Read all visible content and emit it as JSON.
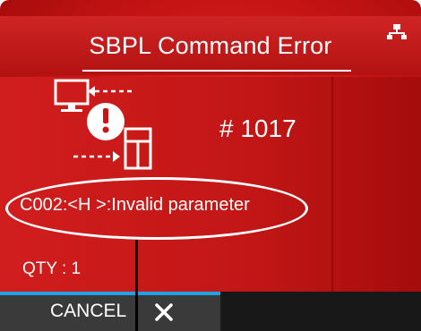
{
  "header": {
    "title": "SBPL Command Error"
  },
  "error": {
    "code": "# 1017",
    "message": "C002:<H >:Invalid parameter",
    "qty": "QTY : 1"
  },
  "footer": {
    "cancel_label": "CANCEL"
  },
  "colors": {
    "background": "#c81515",
    "accent_line": "#1ea3e6",
    "text": "#ffffff",
    "footer": "#1c1c1c"
  },
  "icons": [
    "network-icon",
    "printer-error-icon",
    "close-icon"
  ]
}
